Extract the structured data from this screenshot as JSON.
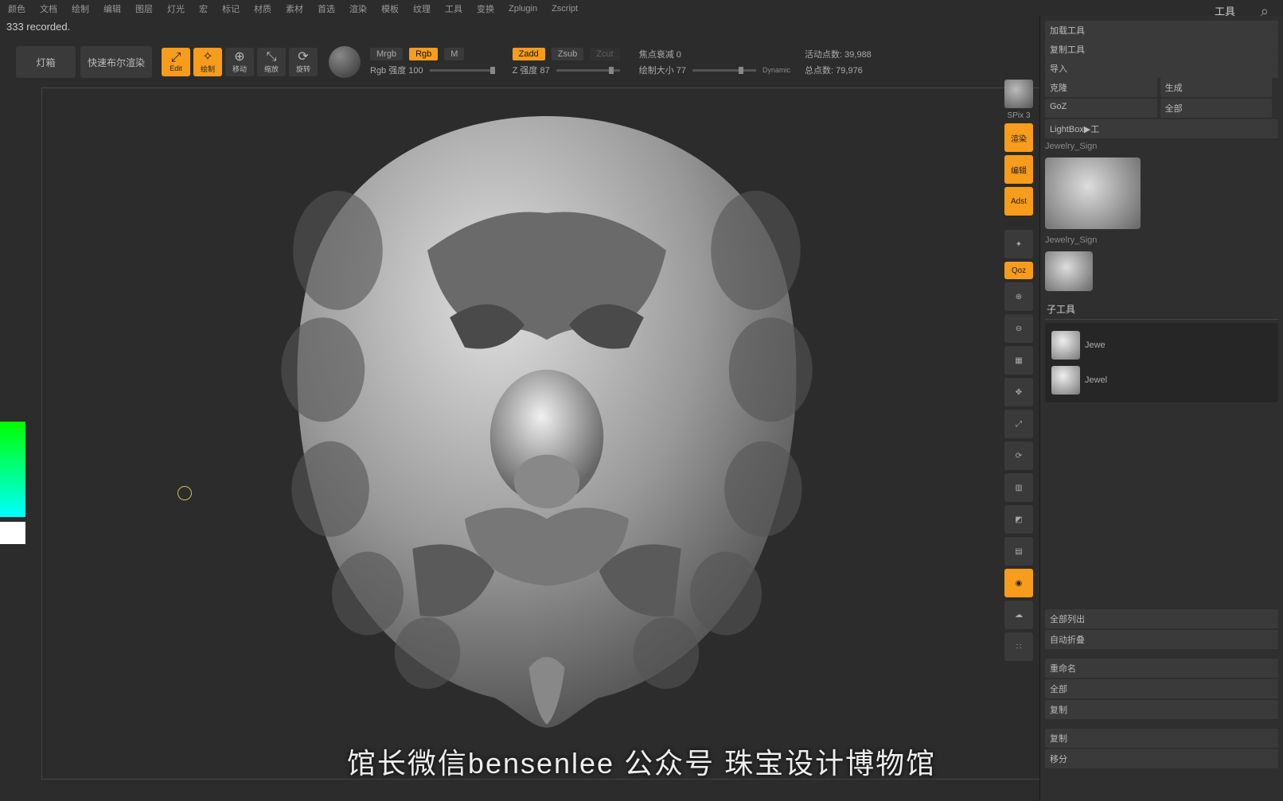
{
  "menu": [
    "颜色",
    "文档",
    "绘制",
    "编辑",
    "图层",
    "灯光",
    "宏",
    "标记",
    "材质",
    "素材",
    "首选",
    "渲染",
    "模板",
    "纹理",
    "工具",
    "变换",
    "Zplugin",
    "Zscript"
  ],
  "status_rec": "333 recorded.",
  "top_right_label": "工具",
  "hdr": {
    "btn1": "灯箱",
    "btn2": "快速布尔渲染"
  },
  "tools": [
    {
      "label": "Edit",
      "g": "⤢",
      "on": true
    },
    {
      "label": "绘制",
      "g": "✧",
      "on": true
    },
    {
      "label": "移动",
      "g": "⊕",
      "on": false
    },
    {
      "label": "缩放",
      "g": "⤡",
      "on": false
    },
    {
      "label": "旋转",
      "g": "⟳",
      "on": false
    }
  ],
  "paint": {
    "mrgb": "Mrgb",
    "rgb": "Rgb",
    "m": "M",
    "rgb_label": "Rgb 强度 100",
    "zadd": "Zadd",
    "zsub": "Zsub",
    "zcut": "Zcut",
    "z_label": "Z 强度 87",
    "focal": "焦点衰减 0",
    "draw": "绘制大小 77",
    "dynamic": "Dynamic"
  },
  "stats": {
    "active": "活动点数: 39,988",
    "total": "总点数: 79,976"
  },
  "right_tools": {
    "spix": "SPix 3",
    "b1": "渲染",
    "b2": "编辑",
    "b3": "Adst",
    "qoz": "Qoz"
  },
  "panel": {
    "items1": [
      "加载工具",
      "复制工具",
      "导入"
    ],
    "pairs": [
      [
        "克隆",
        "生成"
      ],
      [
        "GoZ",
        "全部"
      ]
    ],
    "lightbox": "LightBox▶工",
    "jewelry": "Jewelry_Sign",
    "subtool_hdr": "子工具",
    "subtools": [
      {
        "name": "Jewe"
      },
      {
        "name": "Jewel"
      }
    ],
    "bottom": [
      "全部列出",
      "自动折叠",
      "",
      "重命名",
      "全部",
      "复制",
      "",
      "复制",
      "移分"
    ]
  },
  "subtitle": "馆长微信bensenlee 公众号 珠宝设计博物馆"
}
